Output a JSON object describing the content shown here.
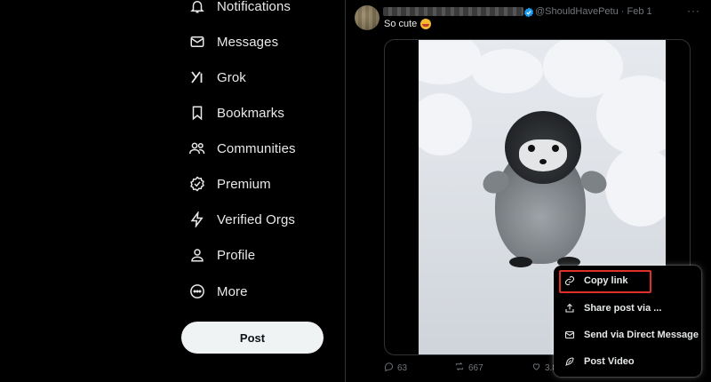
{
  "sidebar": {
    "items": [
      {
        "label": "Notifications",
        "icon": "bell-icon"
      },
      {
        "label": "Messages",
        "icon": "envelope-icon"
      },
      {
        "label": "Grok",
        "icon": "grok-icon"
      },
      {
        "label": "Bookmarks",
        "icon": "bookmark-icon"
      },
      {
        "label": "Communities",
        "icon": "people-icon"
      },
      {
        "label": "Premium",
        "icon": "premium-badge-icon"
      },
      {
        "label": "Verified Orgs",
        "icon": "lightning-icon"
      },
      {
        "label": "Profile",
        "icon": "person-icon"
      },
      {
        "label": "More",
        "icon": "more-circle-icon"
      }
    ],
    "post_button_label": "Post"
  },
  "tweet": {
    "handle": "@ShouldHavePetu",
    "date": "Feb 1",
    "handle_line": "@ShouldHavePetu · Feb 1",
    "text": "So cute",
    "more_label": "···",
    "actions": {
      "replies": "63",
      "reposts": "667",
      "likes": "3.8"
    }
  },
  "menu": {
    "items": [
      {
        "label": "Copy link",
        "icon": "link-icon"
      },
      {
        "label": "Share post via ...",
        "icon": "share-icon"
      },
      {
        "label": "Send via Direct Message",
        "icon": "envelope-icon"
      },
      {
        "label": "Post Video",
        "icon": "feather-icon"
      }
    ]
  },
  "colors": {
    "background": "#000000",
    "text": "#e7e9ea",
    "muted": "#71767b",
    "verified": "#1d9bf0",
    "highlight": "#e0302a",
    "post_button": "#eff3f4"
  }
}
